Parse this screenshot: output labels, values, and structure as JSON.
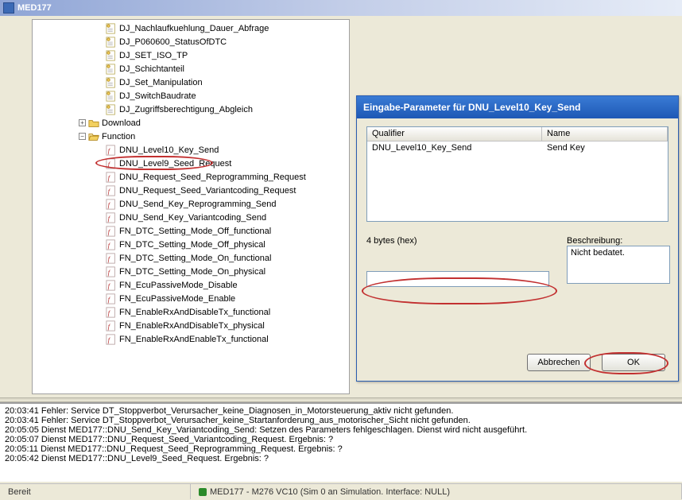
{
  "window": {
    "title": "MED177"
  },
  "tree": {
    "top_items": [
      "DJ_Nachlaufkuehlung_Dauer_Abfrage",
      "DJ_P060600_StatusOfDTC",
      "DJ_SET_ISO_TP",
      "DJ_Schichtanteil",
      "DJ_Set_Manipulation",
      "DJ_SwitchBaudrate",
      "DJ_Zugriffsberechtigung_Abgleich"
    ],
    "download_label": "Download",
    "function_label": "Function",
    "function_items": [
      "DNU_Level10_Key_Send",
      "DNU_Level9_Seed_Request",
      "DNU_Request_Seed_Reprogramming_Request",
      "DNU_Request_Seed_Variantcoding_Request",
      "DNU_Send_Key_Reprogramming_Send",
      "DNU_Send_Key_Variantcoding_Send",
      "FN_DTC_Setting_Mode_Off_functional",
      "FN_DTC_Setting_Mode_Off_physical",
      "FN_DTC_Setting_Mode_On_functional",
      "FN_DTC_Setting_Mode_On_physical",
      "FN_EcuPassiveMode_Disable",
      "FN_EcuPassiveMode_Enable",
      "FN_EnableRxAndDisableTx_functional",
      "FN_EnableRxAndDisableTx_physical",
      "FN_EnableRxAndEnableTx_functional"
    ]
  },
  "dialog": {
    "title": "Eingabe-Parameter für DNU_Level10_Key_Send",
    "list": {
      "qualifier_header": "Qualifier",
      "name_header": "Name",
      "row_qualifier": "DNU_Level10_Key_Send",
      "row_name": "Send Key"
    },
    "input_label": "4 bytes (hex)",
    "input_value": "",
    "desc_label": "Beschreibung:",
    "desc_value": "Nicht bedatet.",
    "cancel_label": "Abbrechen",
    "ok_label": "OK"
  },
  "log": [
    "       20:03:41 Fehler: Service DT_Stoppverbot_Verursacher_keine_Diagnosen_in_Motorsteuerung_aktiv nicht gefunden.",
    "       20:03:41 Fehler: Service DT_Stoppverbot_Verursacher_keine_Startanforderung_aus_motorischer_Sicht nicht gefunden.",
    "       20:05:05 Dienst MED177::DNU_Send_Key_Variantcoding_Send: Setzen des Parameters fehlgeschlagen. Dienst wird nicht ausgeführt.",
    "20:05:07 Dienst MED177::DNU_Request_Seed_Variantcoding_Request. Ergebnis: ?",
    "20:05:11 Dienst MED177::DNU_Request_Seed_Reprogramming_Request. Ergebnis: ?",
    "20:05:42 Dienst MED177::DNU_Level9_Seed_Request. Ergebnis: ?"
  ],
  "status": {
    "ready": "Bereit",
    "conn": "MED177 - M276  VC10 (Sim 0 an Simulation. Interface: NULL)"
  }
}
